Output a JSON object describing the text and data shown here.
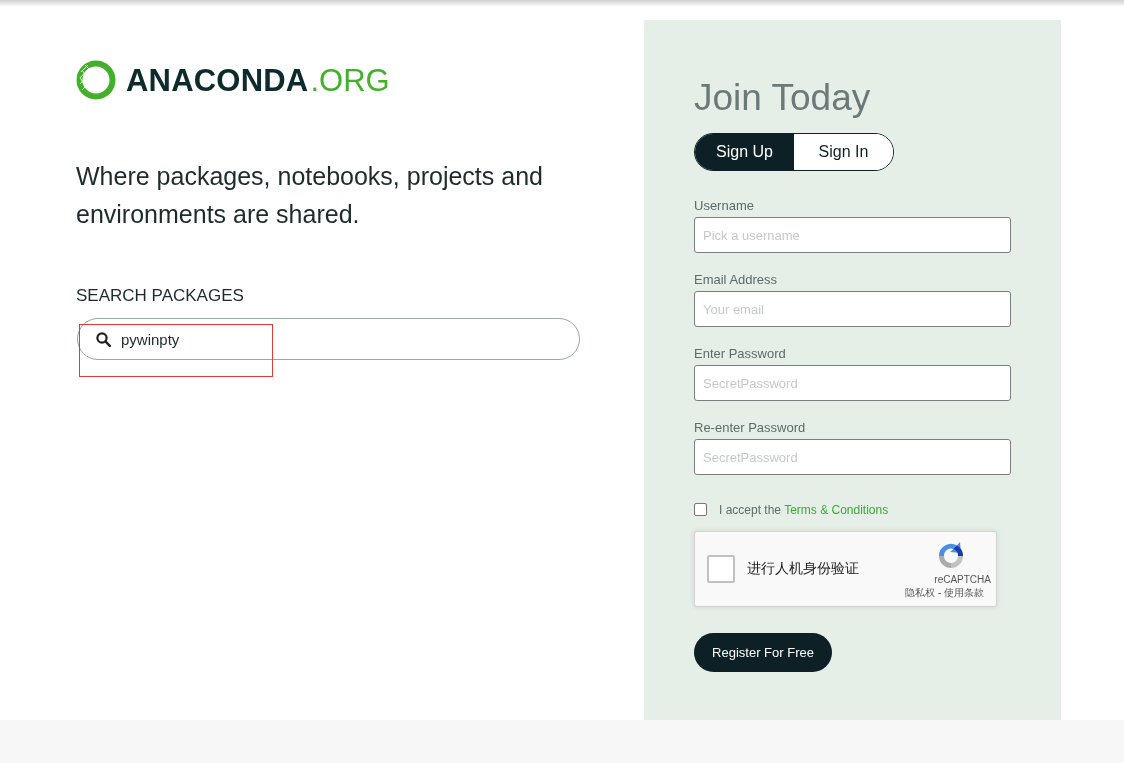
{
  "logo": {
    "name": "ANACONDA",
    "domain": ".ORG"
  },
  "tagline": "Where packages, notebooks, projects and environments are shared.",
  "search": {
    "heading": "SEARCH PACKAGES",
    "value": "pywinpty",
    "highlighted": true
  },
  "join": {
    "title": "Join Today",
    "tabs": [
      {
        "label": "Sign Up",
        "selected": true
      },
      {
        "label": "Sign In",
        "selected": false
      }
    ],
    "fields": [
      {
        "label": "Username",
        "placeholder": "Pick a username"
      },
      {
        "label": "Email Address",
        "placeholder": "Your email"
      },
      {
        "label": "Enter Password",
        "placeholder": "SecretPassword"
      },
      {
        "label": "Re-enter Password",
        "placeholder": "SecretPassword"
      }
    ],
    "terms": {
      "checked": false,
      "text": "I accept the",
      "link": "Terms & Conditions"
    },
    "captcha": {
      "checked": false,
      "prompt": "进行人机身份验证",
      "brand": "reCAPTCHA",
      "links": "隐私权 - 使用条款"
    },
    "submit": "Register For Free"
  }
}
